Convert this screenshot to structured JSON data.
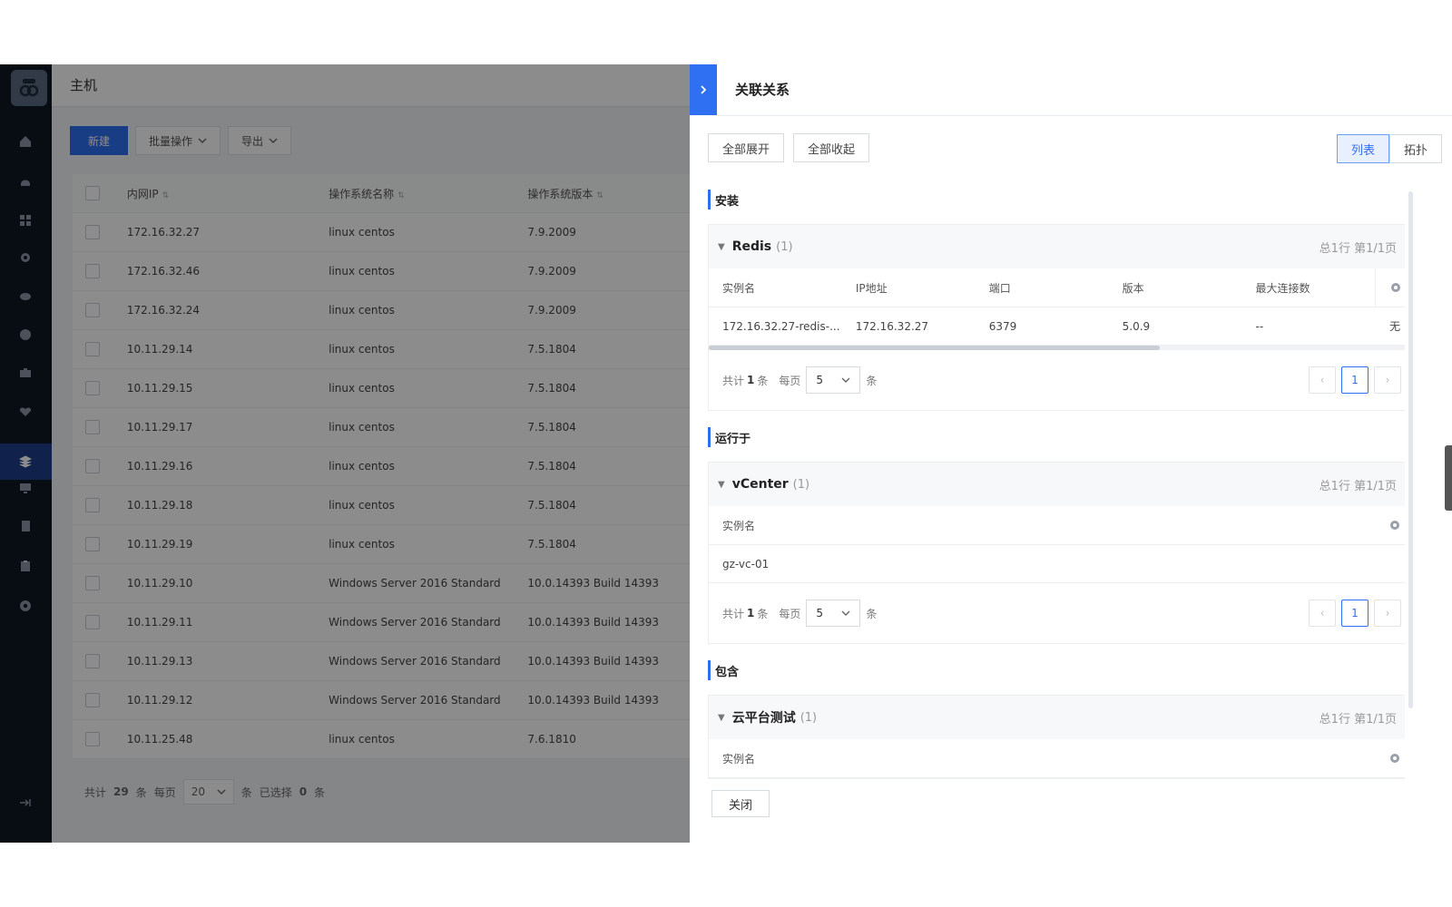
{
  "main": {
    "title": "主机",
    "new_label": "新建",
    "batch_label": "批量操作",
    "export_label": "导出",
    "columns": [
      "内网IP",
      "操作系统名称",
      "操作系统版本"
    ],
    "rows": [
      [
        "172.16.32.27",
        "linux centos",
        "7.9.2009"
      ],
      [
        "172.16.32.46",
        "linux centos",
        "7.9.2009"
      ],
      [
        "172.16.32.24",
        "linux centos",
        "7.9.2009"
      ],
      [
        "10.11.29.14",
        "linux centos",
        "7.5.1804"
      ],
      [
        "10.11.29.15",
        "linux centos",
        "7.5.1804"
      ],
      [
        "10.11.29.17",
        "linux centos",
        "7.5.1804"
      ],
      [
        "10.11.29.16",
        "linux centos",
        "7.5.1804"
      ],
      [
        "10.11.29.18",
        "linux centos",
        "7.5.1804"
      ],
      [
        "10.11.29.19",
        "linux centos",
        "7.5.1804"
      ],
      [
        "10.11.29.10",
        "Windows Server 2016 Standard",
        "10.0.14393 Build 14393"
      ],
      [
        "10.11.29.11",
        "Windows Server 2016 Standard",
        "10.0.14393 Build 14393"
      ],
      [
        "10.11.29.13",
        "Windows Server 2016 Standard",
        "10.0.14393 Build 14393"
      ],
      [
        "10.11.29.12",
        "Windows Server 2016 Standard",
        "10.0.14393 Build 14393"
      ],
      [
        "10.11.25.48",
        "linux centos",
        "7.6.1810"
      ]
    ],
    "footer": {
      "total_prefix": "共计",
      "total": "29",
      "total_suffix": "条",
      "per_page": "每页",
      "page_size": "20",
      "unit": "条",
      "selected_prefix": "已选择",
      "selected": "0",
      "selected_suffix": "条"
    }
  },
  "drawer": {
    "title": "关联关系",
    "expand_all": "全部展开",
    "collapse_all": "全部收起",
    "view_list": "列表",
    "view_topo": "拓扑",
    "close": "关闭",
    "sections": {
      "install": {
        "title": "安装",
        "card": {
          "name": "Redis",
          "count": "(1)",
          "summary": "总1行 第1/1页",
          "columns": [
            "实例名",
            "IP地址",
            "端口",
            "版本",
            "最大连接数"
          ],
          "row": [
            "172.16.32.27-redis-...",
            "172.16.32.27",
            "6379",
            "5.0.9",
            "--",
            "无"
          ],
          "footer": {
            "total_prefix": "共计",
            "total": "1",
            "total_suffix": "条",
            "per_page": "每页",
            "page_size": "5",
            "unit": "条",
            "page": "1"
          }
        }
      },
      "runs_on": {
        "title": "运行于",
        "card": {
          "name": "vCenter",
          "count": "(1)",
          "summary": "总1行 第1/1页",
          "column": "实例名",
          "row": "gz-vc-01",
          "footer": {
            "total_prefix": "共计",
            "total": "1",
            "total_suffix": "条",
            "per_page": "每页",
            "page_size": "5",
            "unit": "条",
            "page": "1"
          }
        }
      },
      "contains": {
        "title": "包含",
        "card": {
          "name": "云平台测试",
          "count": "(1)",
          "summary": "总1行 第1/1页",
          "column": "实例名"
        }
      }
    }
  },
  "colors": {
    "primary": "#2f6ff2",
    "sidebar_bg": "#0f1624"
  },
  "icons": [
    "home-icon",
    "alert-icon",
    "apps-icon",
    "location-icon",
    "cloud-icon",
    "globe-icon",
    "briefcase-icon",
    "heart-icon",
    "layers-icon",
    "monitor-icon",
    "book-icon",
    "clipboard-icon",
    "settings-icon",
    "collapse-icon",
    "gear-icon",
    "chevron-right-icon",
    "chevron-down-icon",
    "triangle-down-icon"
  ]
}
